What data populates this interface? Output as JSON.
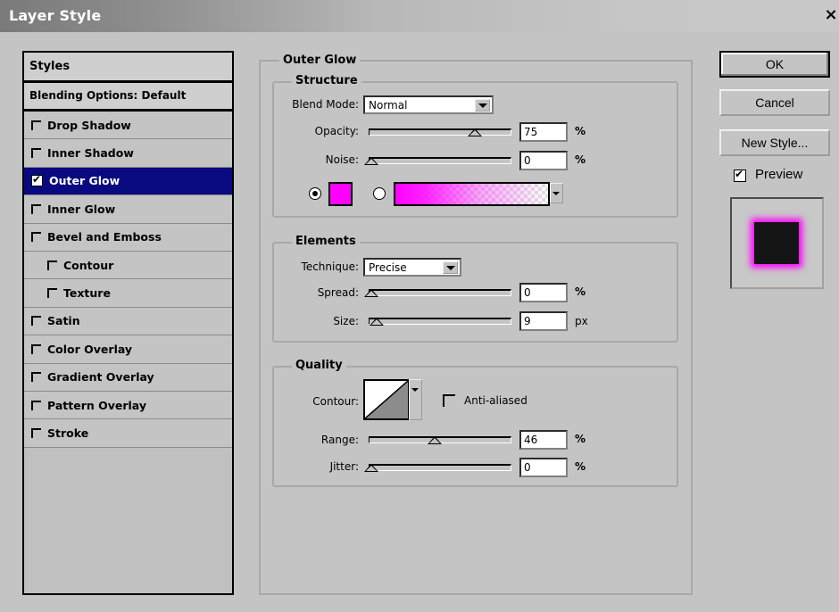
{
  "window": {
    "title": "Layer Style",
    "close_label": "×"
  },
  "styles_panel": {
    "header": "Styles",
    "blending_options": "Blending Options: Default",
    "items": [
      {
        "label": "Drop Shadow",
        "checked": false,
        "indent": false,
        "selected": false
      },
      {
        "label": "Inner Shadow",
        "checked": false,
        "indent": false,
        "selected": false
      },
      {
        "label": "Outer Glow",
        "checked": true,
        "indent": false,
        "selected": true
      },
      {
        "label": "Inner Glow",
        "checked": false,
        "indent": false,
        "selected": false
      },
      {
        "label": "Bevel and Emboss",
        "checked": false,
        "indent": false,
        "selected": false
      },
      {
        "label": "Contour",
        "checked": false,
        "indent": true,
        "selected": false
      },
      {
        "label": "Texture",
        "checked": false,
        "indent": true,
        "selected": false
      },
      {
        "label": "Satin",
        "checked": false,
        "indent": false,
        "selected": false
      },
      {
        "label": "Color Overlay",
        "checked": false,
        "indent": false,
        "selected": false
      },
      {
        "label": "Gradient Overlay",
        "checked": false,
        "indent": false,
        "selected": false
      },
      {
        "label": "Pattern Overlay",
        "checked": false,
        "indent": false,
        "selected": false
      },
      {
        "label": "Stroke",
        "checked": false,
        "indent": false,
        "selected": false
      }
    ]
  },
  "outer_glow": {
    "title": "Outer Glow",
    "structure": {
      "title": "Structure",
      "blend_mode_label": "Blend Mode:",
      "blend_mode_value": "Normal",
      "opacity_label": "Opacity:",
      "opacity_value": "75",
      "opacity_level": 0.75,
      "noise_label": "Noise:",
      "noise_value": "0",
      "noise_level": 0,
      "percent": "%",
      "glow_color": "#ff00ff",
      "color_mode": "solid"
    },
    "elements": {
      "title": "Elements",
      "technique_label": "Technique:",
      "technique_value": "Precise",
      "spread_label": "Spread:",
      "spread_value": "0",
      "spread_level": 0,
      "size_label": "Size:",
      "size_value": "9",
      "size_level": 0.04,
      "percent": "%",
      "px": "px"
    },
    "quality": {
      "title": "Quality",
      "contour_label": "Contour:",
      "anti_aliased_label": "Anti-aliased",
      "anti_aliased": false,
      "range_label": "Range:",
      "range_value": "46",
      "range_level": 0.46,
      "jitter_label": "Jitter:",
      "jitter_value": "0",
      "jitter_level": 0,
      "percent": "%"
    }
  },
  "buttons": {
    "ok": "OK",
    "cancel": "Cancel",
    "new_style": "New Style...",
    "preview_label": "Preview",
    "preview_checked": true
  },
  "colors": {
    "selection": "#0a0a80",
    "glow": "#ff00ff",
    "dialog_bg": "#c4c4c4"
  }
}
